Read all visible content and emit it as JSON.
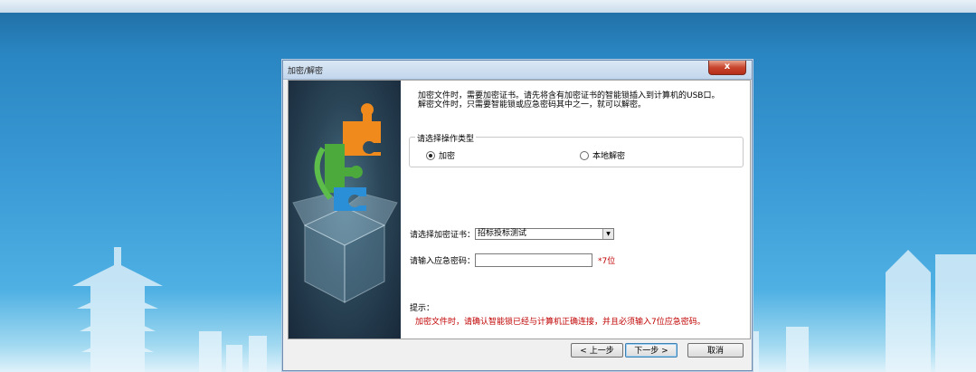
{
  "dialog": {
    "title": "加密/解密",
    "close_label": "x",
    "intro_line1": "加密文件时，需要加密证书。请先将含有加密证书的智能锁插入到计算机的USB口。",
    "intro_line2": "解密文件时，只需要智能锁或应急密码其中之一，就可以解密。",
    "op_group": {
      "label": "请选择操作类型",
      "options": [
        {
          "label": "加密",
          "selected": true
        },
        {
          "label": "本地解密",
          "selected": false
        }
      ]
    },
    "cert": {
      "label": "请选择加密证书：",
      "value": "招标投标测试"
    },
    "password": {
      "label": "请输入应急密码：",
      "value": "",
      "requirement": "*7位"
    },
    "tip": {
      "label": "提示：",
      "text": "加密文件时，请确认智能锁已经与计算机正确连接，并且必须输入7位应急密码。"
    },
    "buttons": {
      "back": "< 上一步",
      "next": "下一步 >",
      "cancel": "取消"
    }
  }
}
